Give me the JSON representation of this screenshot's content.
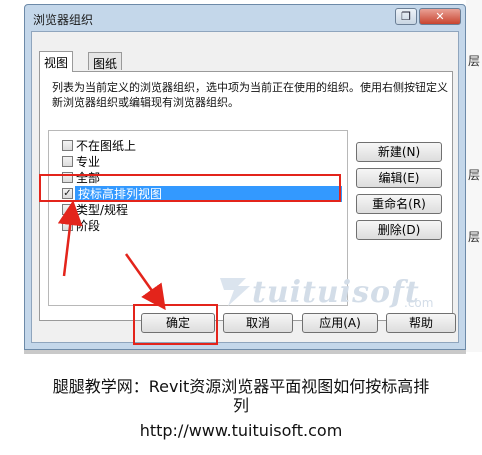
{
  "window": {
    "title": "浏览器组织",
    "restore_icon": "restore-icon",
    "close_icon": "close-icon",
    "close_glyph": "✕",
    "restore_glyph": "❐"
  },
  "tabs": [
    {
      "label": "视图",
      "active": true
    },
    {
      "label": "图纸",
      "active": false
    }
  ],
  "description": "列表为当前定义的浏览器组织，选中项为当前正在使用的组织。使用右侧按钮定义新浏览器组织或编辑现有浏览器组织。",
  "list": [
    {
      "label": "不在图纸上",
      "checked": false,
      "selected": false
    },
    {
      "label": "专业",
      "checked": false,
      "selected": false
    },
    {
      "label": "全部",
      "checked": false,
      "selected": false
    },
    {
      "label": "按标高排列视图",
      "checked": true,
      "selected": true
    },
    {
      "label": "类型/规程",
      "checked": false,
      "selected": false
    },
    {
      "label": "阶段",
      "checked": false,
      "selected": false
    }
  ],
  "check_glyph": "✓",
  "side_buttons": {
    "new": "新建(N)",
    "edit": "编辑(E)",
    "rename": "重命名(R)",
    "delete": "删除(D)"
  },
  "bottom_buttons": {
    "ok": "确定",
    "cancel": "取消",
    "apply": "应用(A)",
    "help": "帮助"
  },
  "watermark": {
    "text": "tuituisoft",
    "suffix": ".com"
  },
  "background_chars": [
    "层",
    "层",
    "层"
  ],
  "caption": {
    "line1": "腿腿教学网：Revit资源浏览器平面视图如何按标高排",
    "line2": "列",
    "line3": "http://www.tuituisoft.com"
  },
  "colors": {
    "annotation_red": "#e3241b",
    "selection_blue": "#3399ff"
  }
}
